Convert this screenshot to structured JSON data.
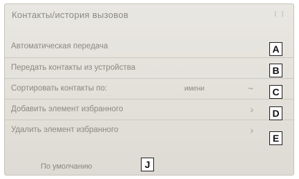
{
  "screen": {
    "title": "Контакты/история вызовов",
    "status_icons": [
      "⁝",
      "⁝"
    ]
  },
  "rows": [
    {
      "label": "Автоматическая передача",
      "value": "",
      "chevron": "",
      "callout": "A"
    },
    {
      "label": "Передать контакты из устройства",
      "value": "",
      "chevron": "",
      "callout": "B"
    },
    {
      "label": "Сортировать контакты по:",
      "value": "имени",
      "chevron": "~",
      "callout": "C"
    },
    {
      "label": "Добавить элемент избранного",
      "value": "",
      "chevron": "›",
      "callout": "D"
    },
    {
      "label": "Удалить элемент избранного",
      "value": "",
      "chevron": "›",
      "callout": "E"
    }
  ],
  "default_button": {
    "label": "По умолчанию",
    "callout": "J"
  }
}
